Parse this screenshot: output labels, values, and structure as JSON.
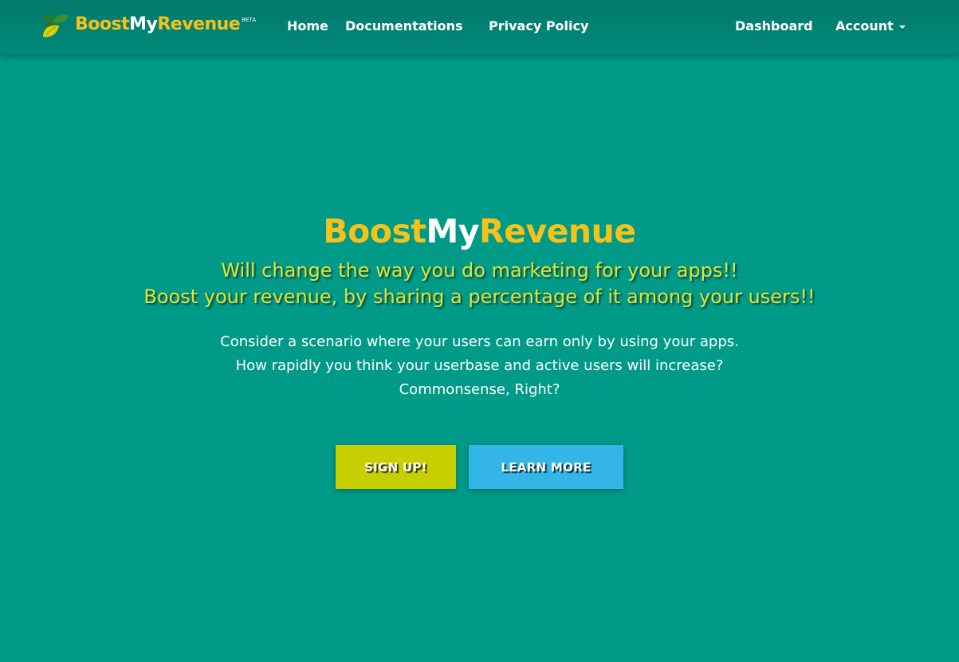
{
  "brand": {
    "part1": "Boost",
    "part2": "My",
    "part3": "Revenue",
    "badge": "BETA",
    "icon": "leaf-logo-icon"
  },
  "nav": {
    "home": "Home",
    "docs": "Documentations",
    "privacy": "Privacy Policy",
    "dashboard": "Dashboard",
    "account": "Account"
  },
  "hero": {
    "title_part1": "Boost",
    "title_part2": "My",
    "title_part3": "Revenue",
    "tagline_line1": "Will change the way you do marketing for your apps!!",
    "tagline_line2": "Boost your revenue, by sharing a percentage of it among your users!!",
    "desc_line1": "Consider a scenario where your users can earn only by using your apps.",
    "desc_line2": "How rapidly you think your userbase and active users will increase?",
    "desc_line3": "Commonsense, Right?"
  },
  "buttons": {
    "signup": "SIGN UP!",
    "learn": "LEARN MORE"
  },
  "colors": {
    "background": "#009a88",
    "navbar": "#017e70",
    "brand_yellow": "#f6c21a",
    "tagline_yellow": "#e2e233",
    "signup_button": "#c8cf00",
    "learn_button": "#33b5e8"
  }
}
